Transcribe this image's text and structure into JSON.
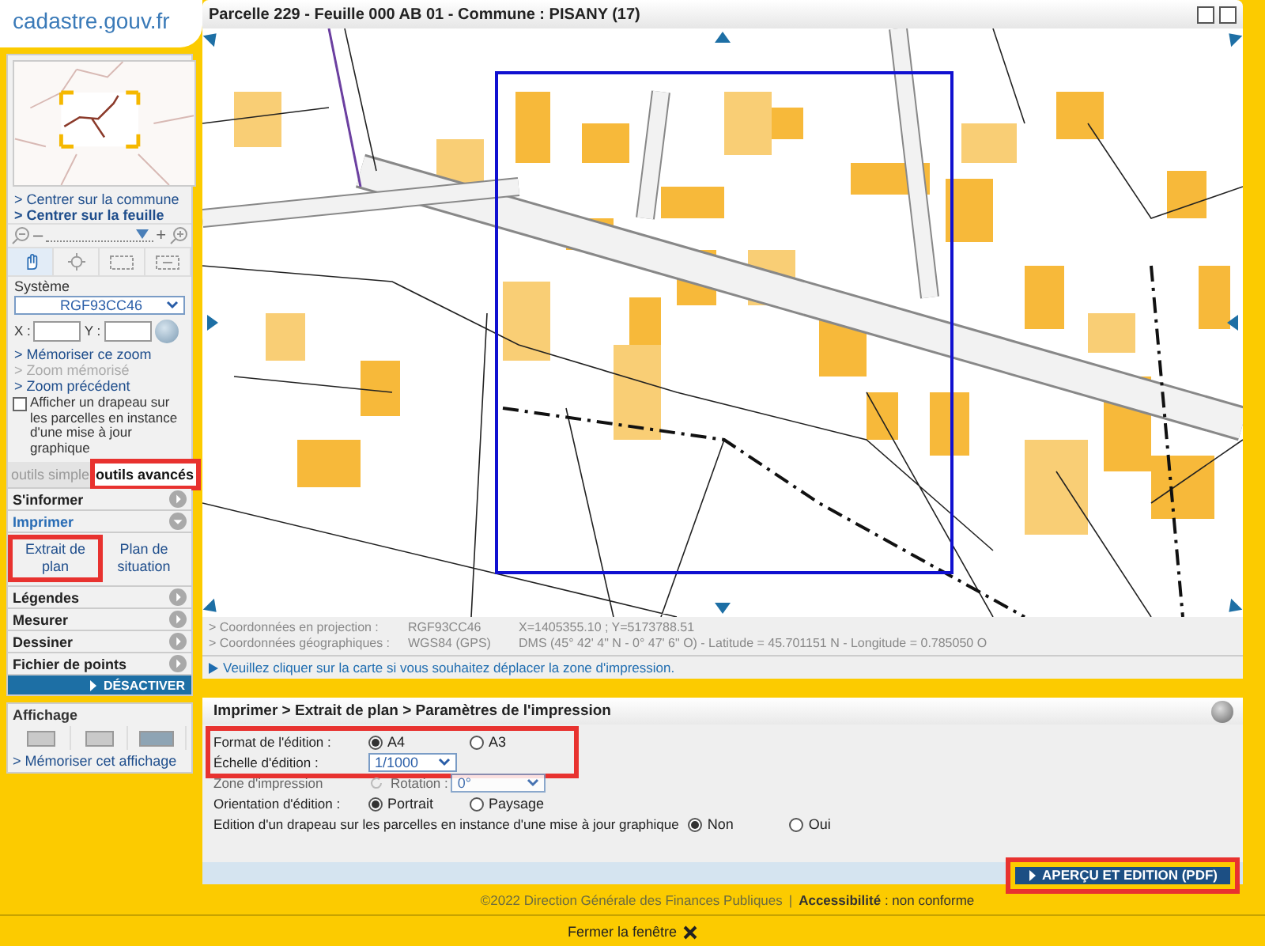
{
  "logo": {
    "text": "cadastre.gouv.fr"
  },
  "sidebar": {
    "links_top": [
      {
        "label": "> Centrer sur la commune",
        "bold": false
      },
      {
        "label": "> Centrer sur la feuille",
        "bold": true
      }
    ],
    "zoom": {
      "minus": "–",
      "plus": "+",
      "level": 0.9
    },
    "tools": [
      {
        "kind": "hand",
        "selected": true
      },
      {
        "kind": "crosshair",
        "selected": false
      },
      {
        "kind": "rect",
        "selected": false
      },
      {
        "kind": "expand",
        "selected": false
      }
    ],
    "system": {
      "label": "Système",
      "value": "RGF93CC46"
    },
    "coords": {
      "x_label": "X :",
      "y_label": "Y :"
    },
    "zoom_links": [
      {
        "label": "> Mémoriser ce zoom",
        "disabled": false
      },
      {
        "label": "> Zoom mémorisé",
        "disabled": true
      },
      {
        "label": "> Zoom précédent",
        "disabled": false
      }
    ],
    "flag_checkbox": {
      "label": "Afficher un drapeau sur les parcelles en instance d'une mise à jour graphique",
      "checked": false
    },
    "tabs": [
      {
        "label": "outils simple",
        "selected": false,
        "highlighted": false
      },
      {
        "label": "outils avancés",
        "selected": true,
        "highlighted": true
      }
    ],
    "sections": [
      {
        "label": "S'informer",
        "expanded": false
      },
      {
        "label": "Imprimer",
        "expanded": true,
        "children": [
          {
            "label": "Extrait de plan",
            "highlighted": true
          },
          {
            "label": "Plan de situation",
            "highlighted": false
          }
        ]
      },
      {
        "label": "Légendes",
        "expanded": false
      },
      {
        "label": "Mesurer",
        "expanded": false
      },
      {
        "label": "Dessiner",
        "expanded": false
      },
      {
        "label": "Fichier de points",
        "expanded": false
      }
    ],
    "deactivate": "DÉSACTIVER",
    "display": {
      "title": "Affichage",
      "layouts": [
        {
          "selected": false
        },
        {
          "selected": false
        },
        {
          "selected": true
        }
      ],
      "link": "> Mémoriser cet affichage"
    }
  },
  "map_window": {
    "title": "Parcelle 229 - Feuille 000 AB 01 - Commune : PISANY (17)",
    "coordinates": [
      {
        "label": "> Coordonnées en projection :",
        "system": "RGF93CC46",
        "value": "X=1405355.10 ; Y=5173788.51"
      },
      {
        "label": "> Coordonnées géographiques :",
        "system": "WGS84 (GPS)",
        "value": "DMS (45° 42' 4\" N - 0° 47' 6\" O) - Latitude = 45.701151 N - Longitude = 0.785050 O"
      }
    ],
    "hint": "Veuillez cliquer sur la carte si vous souhaitez déplacer la zone d'impression."
  },
  "print_panel": {
    "breadcrumb": "Imprimer > Extrait de plan > Paramètres de l'impression",
    "groups": [
      {
        "highlighted": true,
        "rows": [
          {
            "kind": "radio",
            "label": "Format de l'édition :",
            "options": [
              {
                "label": "A4",
                "selected": true
              },
              {
                "label": "A3",
                "selected": false
              }
            ]
          },
          {
            "kind": "select",
            "label": "Échelle d'édition :",
            "value": "1/1000"
          }
        ]
      },
      {
        "highlighted": false,
        "rows": [
          {
            "kind": "rotation",
            "label": "Zone d'impression",
            "rotation_label": "Rotation :",
            "value": "0°",
            "disabled": true
          },
          {
            "kind": "radio",
            "label": "Orientation d'édition :",
            "options": [
              {
                "label": "Portrait",
                "selected": true
              },
              {
                "label": "Paysage",
                "selected": false
              }
            ]
          },
          {
            "kind": "radio",
            "label": "Edition d'un drapeau sur les parcelles en instance d'une mise à jour graphique",
            "options": [
              {
                "label": "Non",
                "selected": true
              },
              {
                "label": "Oui",
                "selected": false
              }
            ]
          }
        ]
      }
    ],
    "button": {
      "label": "APERÇU ET EDITION (PDF)",
      "highlighted": true
    }
  },
  "footer": {
    "copyright": "©2022 Direction Générale des Finances Publiques",
    "separator": "|",
    "accessibility": "**Accessibilité** : non conforme",
    "close": "Fermer la fenêtre"
  }
}
